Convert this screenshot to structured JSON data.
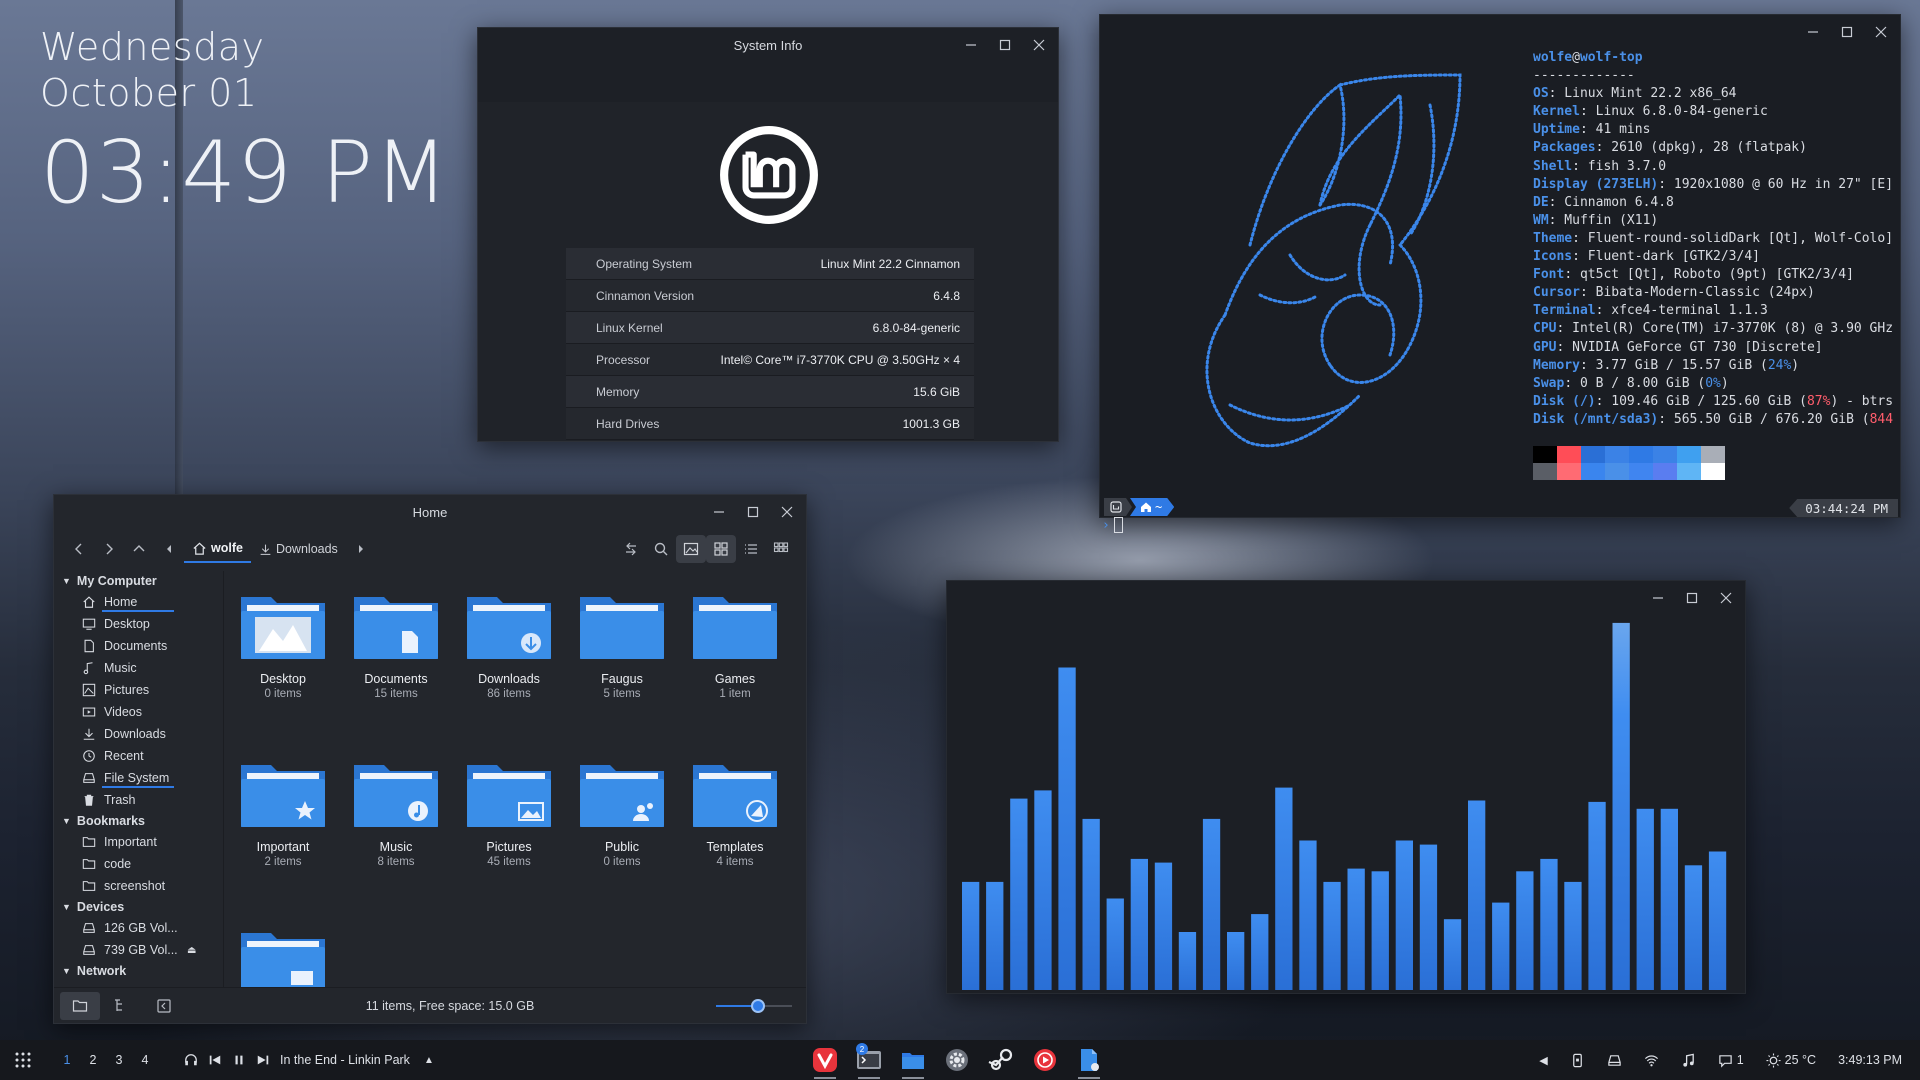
{
  "desktop": {
    "clock": {
      "day": "Wednesday",
      "date": "October 01",
      "time": "03:49 PM"
    }
  },
  "sysinfo": {
    "title": "System Info",
    "rows": [
      {
        "key": "Operating System",
        "value": "Linux Mint 22.2 Cinnamon"
      },
      {
        "key": "Cinnamon Version",
        "value": "6.4.8"
      },
      {
        "key": "Linux Kernel",
        "value": "6.8.0-84-generic"
      },
      {
        "key": "Processor",
        "value": "Intel© Core™ i7-3770K CPU @ 3.50GHz × 4"
      },
      {
        "key": "Memory",
        "value": "15.6 GiB"
      },
      {
        "key": "Hard Drives",
        "value": "1001.3 GB"
      }
    ]
  },
  "terminal": {
    "user": "wolfe",
    "at": "@",
    "host": "wolf-top",
    "separator": "-------------",
    "lines": [
      {
        "label": "OS",
        "value": ": Linux Mint 22.2 x86_64"
      },
      {
        "label": "Kernel",
        "value": ": Linux 6.8.0-84-generic"
      },
      {
        "label": "Uptime",
        "value": ": 41 mins"
      },
      {
        "label": "Packages",
        "value": ": 2610 (dpkg), 28 (flatpak)"
      },
      {
        "label": "Shell",
        "value": ": fish 3.7.0"
      },
      {
        "label": "Display (273ELH)",
        "value": ": 1920x1080 @ 60 Hz in 27\" [E]"
      },
      {
        "label": "DE",
        "value": ": Cinnamon 6.4.8"
      },
      {
        "label": "WM",
        "value": ": Muffin (X11)"
      },
      {
        "label": "Theme",
        "value": ": Fluent-round-solidDark [Qt], Wolf-Colo]"
      },
      {
        "label": "Icons",
        "value": ": Fluent-dark [GTK2/3/4]"
      },
      {
        "label": "Font",
        "value": ": qt5ct [Qt], Roboto (9pt) [GTK2/3/4]"
      },
      {
        "label": "Cursor",
        "value": ": Bibata-Modern-Classic (24px)"
      },
      {
        "label": "Terminal",
        "value": ": xfce4-terminal 1.1.3"
      },
      {
        "label": "CPU",
        "value": ": Intel(R) Core(TM) i7-3770K (8) @ 3.90 GHz"
      },
      {
        "label": "GPU",
        "value": ": NVIDIA GeForce GT 730 [Discrete]"
      }
    ],
    "memory": {
      "label": "Memory",
      "pre": ": 3.77 GiB / 15.57 GiB (",
      "pct": "24%",
      "post": ")"
    },
    "swap": {
      "label": "Swap",
      "pre": ": 0 B / 8.00 GiB (",
      "pct": "0%",
      "post": ")"
    },
    "disk1": {
      "label": "Disk (/)",
      "pre": ": 109.46 GiB / 125.60 GiB (",
      "pct": "87%",
      "post": ") - btrs"
    },
    "disk2": {
      "label": "Disk (/mnt/sda3)",
      "pre": ": 565.50 GiB / 676.20 GiB (",
      "pct": "844",
      "post": ""
    },
    "palette_top": [
      "#000000",
      "#ff4d57",
      "#2a6fd6",
      "#3b82e6",
      "#2f7ae5",
      "#3b82e6",
      "#3fa0f0",
      "#a9aeb7"
    ],
    "palette_bottom": [
      "#5a5e66",
      "#ff6b73",
      "#3a85ee",
      "#4a90e8",
      "#4085f0",
      "#5a7df0",
      "#5fb5f5",
      "#ffffff"
    ],
    "prompt_home": "~",
    "prompt_time": "03:44:24 PM"
  },
  "visualizer": {
    "levels": [
      0.235,
      0.235,
      0.416,
      0.434,
      0.701,
      0.372,
      0.199,
      0.285,
      0.277,
      0.126,
      0.372,
      0.126,
      0.165,
      0.44,
      0.325,
      0.235,
      0.264,
      0.258,
      0.325,
      0.316,
      0.154,
      0.412,
      0.19,
      0.258,
      0.285,
      0.235,
      0.409,
      0.798,
      0.394,
      0.394,
      0.271,
      0.301
    ]
  },
  "filemanager": {
    "title": "Home",
    "breadcrumb_home": "wolfe",
    "breadcrumb_next": "Downloads",
    "sidebar": {
      "my_computer": "My Computer",
      "items": [
        "Home",
        "Desktop",
        "Documents",
        "Music",
        "Pictures",
        "Videos",
        "Downloads",
        "Recent",
        "File System",
        "Trash"
      ],
      "bookmarks": "Bookmarks",
      "bookmark_items": [
        "Important",
        "code",
        "screenshot"
      ],
      "devices": "Devices",
      "device_items": [
        "126 GB Vol...",
        "739 GB Vol..."
      ],
      "network": "Network"
    },
    "folders": [
      {
        "name": "Desktop",
        "count": "0 items"
      },
      {
        "name": "Documents",
        "count": "15 items"
      },
      {
        "name": "Downloads",
        "count": "86 items"
      },
      {
        "name": "Faugus",
        "count": "5 items"
      },
      {
        "name": "Games",
        "count": "1 item"
      },
      {
        "name": "Important",
        "count": "2 items"
      },
      {
        "name": "Music",
        "count": "8 items"
      },
      {
        "name": "Pictures",
        "count": "45 items"
      },
      {
        "name": "Public",
        "count": "0 items"
      },
      {
        "name": "Templates",
        "count": "4 items"
      }
    ],
    "status": "11 items, Free space: 15.0 GB",
    "zoom_level": 0.55
  },
  "taskbar": {
    "workspaces": [
      "1",
      "2",
      "3",
      "4"
    ],
    "now_playing": "In the End - Linkin Park",
    "terminal_badge": "2",
    "notifications": "1",
    "weather": "25 °C",
    "time": "3:49:13 PM"
  },
  "colors": {
    "accent": "#2f7ae5",
    "folder": "#3a8ee8",
    "folder_dark": "#2b76d2",
    "window_bg": "#1f2228",
    "bar": "#2f7ae5"
  }
}
